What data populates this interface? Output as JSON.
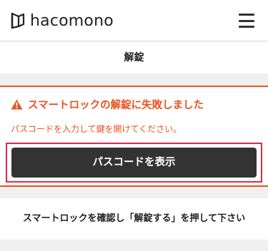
{
  "header": {
    "brand": "hacomono",
    "logo_icon": "hacomono-logo-icon",
    "menu_icon": "hamburger-menu-icon"
  },
  "page": {
    "title": "解錠"
  },
  "alert": {
    "icon": "warning-icon",
    "color": "#e8541e",
    "title": "スマートロックの解錠に失敗しました",
    "message": "パスコードを入力して鍵を開けてください。",
    "button_label": "パスコードを表示",
    "highlight_color": "#e8264c"
  },
  "instruction": {
    "text": "スマートロックを確認し「解錠する」を押して下さい"
  }
}
